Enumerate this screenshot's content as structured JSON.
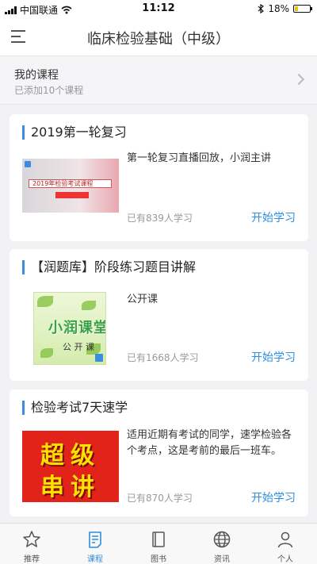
{
  "status_bar": {
    "carrier": "中国联通",
    "time": "11:12",
    "battery": "18%"
  },
  "header": {
    "title": "临床检验基础（中级）"
  },
  "my_courses": {
    "title": "我的课程",
    "subtitle": "已添加10个课程"
  },
  "courses": [
    {
      "title": "2019第一轮复习",
      "description": "第一轮复习直播回放，小润主讲",
      "learners": "已有839人学习",
      "action": "开始学习",
      "thumb_text": "2019年检验考试课程"
    },
    {
      "title": "【润题库】阶段练习题目讲解",
      "description": "公开课",
      "learners": "已有1668人学习",
      "action": "开始学习",
      "thumb_brand": "小润课堂",
      "thumb_open": "公 开 课"
    },
    {
      "title": "检验考试7天速学",
      "description": "适用近期有考试的同学，速学检验各个考点，这是考前的最后一班车。",
      "learners": "已有870人学习",
      "action": "开始学习",
      "thumb_line1": "超级",
      "thumb_line2": "串讲"
    }
  ],
  "tabs": [
    {
      "label": "推荐",
      "icon": "star-icon",
      "active": false
    },
    {
      "label": "课程",
      "icon": "course-icon",
      "active": true
    },
    {
      "label": "图书",
      "icon": "book-icon",
      "active": false
    },
    {
      "label": "资讯",
      "icon": "globe-icon",
      "active": false
    },
    {
      "label": "个人",
      "icon": "person-icon",
      "active": false
    }
  ],
  "colors": {
    "accent": "#2f8ee0",
    "inactive_icon": "#555555"
  }
}
